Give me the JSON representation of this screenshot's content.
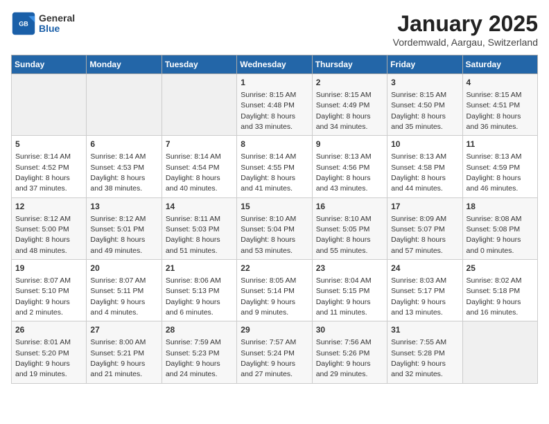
{
  "header": {
    "logo_general": "General",
    "logo_blue": "Blue",
    "title": "January 2025",
    "subtitle": "Vordemwald, Aargau, Switzerland"
  },
  "weekdays": [
    "Sunday",
    "Monday",
    "Tuesday",
    "Wednesday",
    "Thursday",
    "Friday",
    "Saturday"
  ],
  "weeks": [
    [
      {
        "day": "",
        "info": ""
      },
      {
        "day": "",
        "info": ""
      },
      {
        "day": "",
        "info": ""
      },
      {
        "day": "1",
        "info": "Sunrise: 8:15 AM\nSunset: 4:48 PM\nDaylight: 8 hours and 33 minutes."
      },
      {
        "day": "2",
        "info": "Sunrise: 8:15 AM\nSunset: 4:49 PM\nDaylight: 8 hours and 34 minutes."
      },
      {
        "day": "3",
        "info": "Sunrise: 8:15 AM\nSunset: 4:50 PM\nDaylight: 8 hours and 35 minutes."
      },
      {
        "day": "4",
        "info": "Sunrise: 8:15 AM\nSunset: 4:51 PM\nDaylight: 8 hours and 36 minutes."
      }
    ],
    [
      {
        "day": "5",
        "info": "Sunrise: 8:14 AM\nSunset: 4:52 PM\nDaylight: 8 hours and 37 minutes."
      },
      {
        "day": "6",
        "info": "Sunrise: 8:14 AM\nSunset: 4:53 PM\nDaylight: 8 hours and 38 minutes."
      },
      {
        "day": "7",
        "info": "Sunrise: 8:14 AM\nSunset: 4:54 PM\nDaylight: 8 hours and 40 minutes."
      },
      {
        "day": "8",
        "info": "Sunrise: 8:14 AM\nSunset: 4:55 PM\nDaylight: 8 hours and 41 minutes."
      },
      {
        "day": "9",
        "info": "Sunrise: 8:13 AM\nSunset: 4:56 PM\nDaylight: 8 hours and 43 minutes."
      },
      {
        "day": "10",
        "info": "Sunrise: 8:13 AM\nSunset: 4:58 PM\nDaylight: 8 hours and 44 minutes."
      },
      {
        "day": "11",
        "info": "Sunrise: 8:13 AM\nSunset: 4:59 PM\nDaylight: 8 hours and 46 minutes."
      }
    ],
    [
      {
        "day": "12",
        "info": "Sunrise: 8:12 AM\nSunset: 5:00 PM\nDaylight: 8 hours and 48 minutes."
      },
      {
        "day": "13",
        "info": "Sunrise: 8:12 AM\nSunset: 5:01 PM\nDaylight: 8 hours and 49 minutes."
      },
      {
        "day": "14",
        "info": "Sunrise: 8:11 AM\nSunset: 5:03 PM\nDaylight: 8 hours and 51 minutes."
      },
      {
        "day": "15",
        "info": "Sunrise: 8:10 AM\nSunset: 5:04 PM\nDaylight: 8 hours and 53 minutes."
      },
      {
        "day": "16",
        "info": "Sunrise: 8:10 AM\nSunset: 5:05 PM\nDaylight: 8 hours and 55 minutes."
      },
      {
        "day": "17",
        "info": "Sunrise: 8:09 AM\nSunset: 5:07 PM\nDaylight: 8 hours and 57 minutes."
      },
      {
        "day": "18",
        "info": "Sunrise: 8:08 AM\nSunset: 5:08 PM\nDaylight: 9 hours and 0 minutes."
      }
    ],
    [
      {
        "day": "19",
        "info": "Sunrise: 8:07 AM\nSunset: 5:10 PM\nDaylight: 9 hours and 2 minutes."
      },
      {
        "day": "20",
        "info": "Sunrise: 8:07 AM\nSunset: 5:11 PM\nDaylight: 9 hours and 4 minutes."
      },
      {
        "day": "21",
        "info": "Sunrise: 8:06 AM\nSunset: 5:13 PM\nDaylight: 9 hours and 6 minutes."
      },
      {
        "day": "22",
        "info": "Sunrise: 8:05 AM\nSunset: 5:14 PM\nDaylight: 9 hours and 9 minutes."
      },
      {
        "day": "23",
        "info": "Sunrise: 8:04 AM\nSunset: 5:15 PM\nDaylight: 9 hours and 11 minutes."
      },
      {
        "day": "24",
        "info": "Sunrise: 8:03 AM\nSunset: 5:17 PM\nDaylight: 9 hours and 13 minutes."
      },
      {
        "day": "25",
        "info": "Sunrise: 8:02 AM\nSunset: 5:18 PM\nDaylight: 9 hours and 16 minutes."
      }
    ],
    [
      {
        "day": "26",
        "info": "Sunrise: 8:01 AM\nSunset: 5:20 PM\nDaylight: 9 hours and 19 minutes."
      },
      {
        "day": "27",
        "info": "Sunrise: 8:00 AM\nSunset: 5:21 PM\nDaylight: 9 hours and 21 minutes."
      },
      {
        "day": "28",
        "info": "Sunrise: 7:59 AM\nSunset: 5:23 PM\nDaylight: 9 hours and 24 minutes."
      },
      {
        "day": "29",
        "info": "Sunrise: 7:57 AM\nSunset: 5:24 PM\nDaylight: 9 hours and 27 minutes."
      },
      {
        "day": "30",
        "info": "Sunrise: 7:56 AM\nSunset: 5:26 PM\nDaylight: 9 hours and 29 minutes."
      },
      {
        "day": "31",
        "info": "Sunrise: 7:55 AM\nSunset: 5:28 PM\nDaylight: 9 hours and 32 minutes."
      },
      {
        "day": "",
        "info": ""
      }
    ]
  ]
}
